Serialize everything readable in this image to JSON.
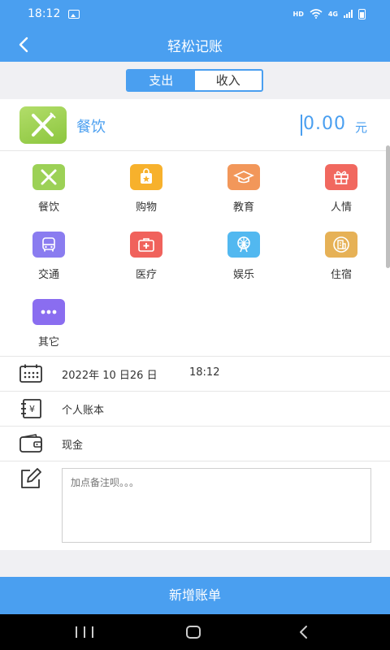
{
  "status_bar": {
    "time": "18:12",
    "hd": "HD",
    "network": "4G"
  },
  "nav": {
    "title": "轻松记账"
  },
  "toggle": {
    "expense": "支出",
    "income": "收入"
  },
  "amount": {
    "category": "餐饮",
    "value": "0.00",
    "unit": "元"
  },
  "categories": [
    {
      "label": "餐饮",
      "icon": "fork-knife-icon",
      "color": "#9cd156"
    },
    {
      "label": "购物",
      "icon": "shopping-bag-icon",
      "color": "#f7b12c"
    },
    {
      "label": "教育",
      "icon": "graduation-cap-icon",
      "color": "#f2975a"
    },
    {
      "label": "人情",
      "icon": "gift-icon",
      "color": "#f1685f"
    },
    {
      "label": "交通",
      "icon": "bus-icon",
      "color": "#8a7cf0"
    },
    {
      "label": "医疗",
      "icon": "medical-kit-icon",
      "color": "#f0625c"
    },
    {
      "label": "娱乐",
      "icon": "ferris-wheel-icon",
      "color": "#52b8f0"
    },
    {
      "label": "住宿",
      "icon": "building-icon",
      "color": "#e6b156"
    },
    {
      "label": "其它",
      "icon": "more-dots-icon",
      "color": "#8a6df0"
    }
  ],
  "details": {
    "date": "2022年 10 日26 日",
    "time": "18:12",
    "book": "个人账本",
    "account": "现金",
    "note_placeholder": "加点备注呗。。。"
  },
  "submit": {
    "label": "新增账单"
  },
  "colors": {
    "primary": "#4a9ff0",
    "background": "#f0f0f3"
  }
}
